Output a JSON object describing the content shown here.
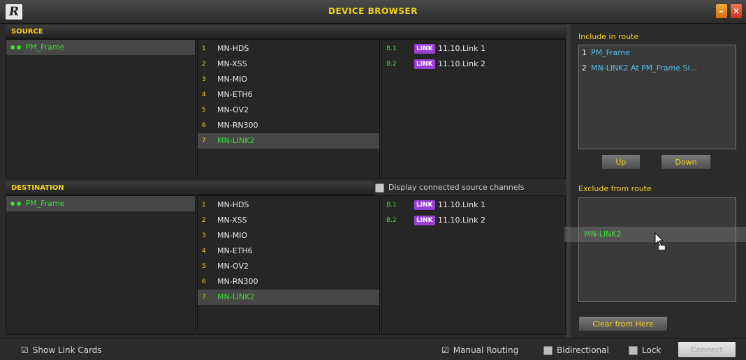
{
  "window": {
    "logo": "R",
    "title": "DEVICE BROWSER",
    "min_icon": "–",
    "close_icon": "✕"
  },
  "source": {
    "header": "SOURCE",
    "frames": [
      {
        "label": "PM_Frame",
        "selected": true
      }
    ],
    "cards": [
      {
        "slot": "1",
        "name": "MN-HDS"
      },
      {
        "slot": "2",
        "name": "MN-XSS"
      },
      {
        "slot": "3",
        "name": "MN-MIO"
      },
      {
        "slot": "4",
        "name": "MN-ETH6"
      },
      {
        "slot": "5",
        "name": "MN-OV2"
      },
      {
        "slot": "6",
        "name": "MN-RN300"
      },
      {
        "slot": "7",
        "name": "MN-LINK2",
        "selected": true
      }
    ],
    "links": [
      {
        "port": "B.1",
        "badge": "LINK",
        "name": "11.10.Link 1"
      },
      {
        "port": "B.2",
        "badge": "LINK",
        "name": "11.10.Link 2"
      }
    ]
  },
  "destination": {
    "header": "DESTINATION",
    "frames": [
      {
        "label": "PM_Frame",
        "selected": true
      }
    ],
    "cards": [
      {
        "slot": "1",
        "name": "MN-HDS"
      },
      {
        "slot": "2",
        "name": "MN-XSS"
      },
      {
        "slot": "3",
        "name": "MN-MIO"
      },
      {
        "slot": "4",
        "name": "MN-ETH6"
      },
      {
        "slot": "5",
        "name": "MN-OV2"
      },
      {
        "slot": "6",
        "name": "MN-RN300"
      },
      {
        "slot": "7",
        "name": "MN-LINK2",
        "selected": true
      }
    ],
    "links": [
      {
        "port": "B.1",
        "badge": "LINK",
        "name": "11.10.Link 1"
      },
      {
        "port": "B.2",
        "badge": "LINK",
        "name": "11.10.Link 2"
      }
    ],
    "display_connected_label": "Display connected source channels"
  },
  "include": {
    "label": "Include in route",
    "items": [
      {
        "index": "1",
        "text": "PM_Frame"
      },
      {
        "index": "2",
        "text": "MN-LINK2  At  PM_Frame Sl..."
      }
    ],
    "up_label": "Up",
    "down_label": "Down"
  },
  "exclude": {
    "label": "Exclude from route",
    "dragged_item": "MN-LINK2",
    "clear_label": "Clear from Here"
  },
  "bottom": {
    "show_link_cards": "Show Link Cards",
    "manual_routing": "Manual Routing",
    "bidirectional": "Bidirectional",
    "lock": "Lock",
    "connect": "Connect"
  },
  "colors": {
    "accent_yellow": "#f2d21e",
    "device_green": "#3ddc36",
    "link_badge_purple": "#9a3fd6",
    "include_blue": "#4fc3e8"
  }
}
